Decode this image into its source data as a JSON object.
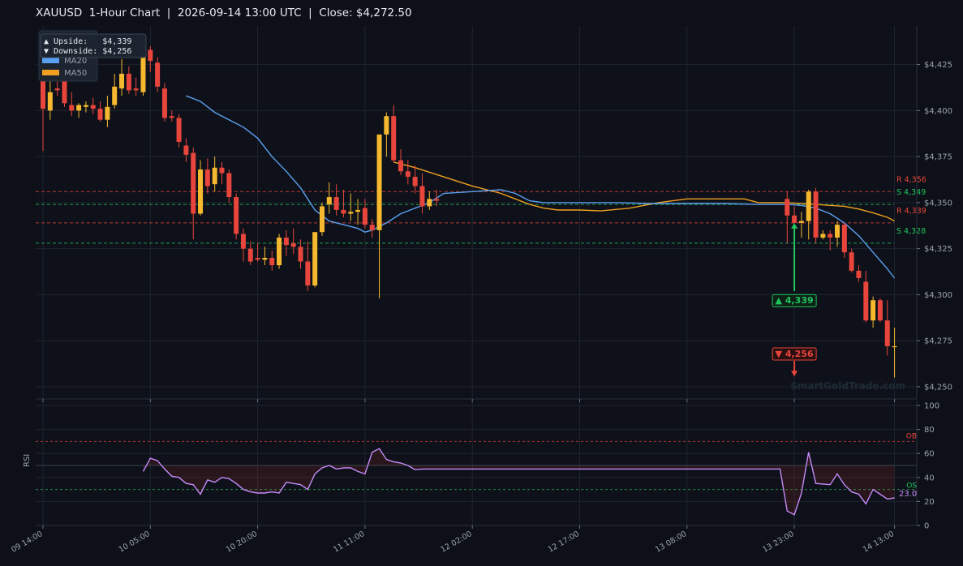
{
  "title": "XAUUSD  1-Hour Chart  |  2026-09-14 13:00 UTC  |  Close: $4,272.50",
  "colors": {
    "bg": "#0d1017",
    "panel": "#0e1119",
    "grid": "#1e242e",
    "up": "#f5b82e",
    "down": "#e8453c",
    "ma20": "#5aa0f0",
    "ma50": "#f0a020",
    "rsi": "#c58af9",
    "resistance": "#e8453c",
    "support": "#22c55e",
    "watermark": "#1f2a36"
  },
  "chart_data": [
    {
      "type": "candlestick",
      "title": "XAUUSD  1-Hour Chart",
      "ylim": [
        4246,
        4442
      ],
      "y_ticks": [
        "$4,250",
        "$4,275",
        "$4,300",
        "$4,325",
        "$4,350",
        "$4,375",
        "$4,400",
        "$4,425"
      ],
      "y_tick_values": [
        4250,
        4275,
        4300,
        4325,
        4350,
        4375,
        4400,
        4425
      ],
      "x_ticks": [
        "09 14:00",
        "10 05:00",
        "10 20:00",
        "11 11:00",
        "12 02:00",
        "12 17:00",
        "13 08:00",
        "13 23:00",
        "14 13:00"
      ],
      "x_tick_index": [
        0,
        15,
        30,
        45,
        60,
        75,
        90,
        105,
        119
      ],
      "ohlc": [
        [
          4418,
          4430,
          4378,
          4401
        ],
        [
          4400,
          4425,
          4395,
          4410
        ],
        [
          4412,
          4432,
          4408,
          4411
        ],
        [
          4422,
          4428,
          4402,
          4404
        ],
        [
          4403,
          4410,
          4397,
          4400
        ],
        [
          4400,
          4404,
          4396,
          4403
        ],
        [
          4402,
          4405,
          4399,
          4403
        ],
        [
          4403,
          4407,
          4398,
          4401
        ],
        [
          4401,
          4405,
          4394,
          4395
        ],
        [
          4395,
          4408,
          4391,
          4402
        ],
        [
          4403,
          4420,
          4401,
          4413
        ],
        [
          4412,
          4428,
          4408,
          4420
        ],
        [
          4420,
          4424,
          4409,
          4411
        ],
        [
          4412,
          4418,
          4408,
          4411
        ],
        [
          4410,
          4432,
          4408,
          4430
        ],
        [
          4433,
          4435,
          4421,
          4427
        ],
        [
          4426,
          4429,
          4410,
          4413
        ],
        [
          4412,
          4415,
          4394,
          4396
        ],
        [
          4397,
          4400,
          4394,
          4396
        ],
        [
          4396,
          4398,
          4380,
          4383
        ],
        [
          4381,
          4385,
          4372,
          4376
        ],
        [
          4377,
          4380,
          4330,
          4344
        ],
        [
          4344,
          4373,
          4343,
          4368
        ],
        [
          4368,
          4374,
          4355,
          4359
        ],
        [
          4360,
          4375,
          4356,
          4369
        ],
        [
          4369,
          4372,
          4360,
          4366
        ],
        [
          4366,
          4368,
          4350,
          4353
        ],
        [
          4353,
          4355,
          4330,
          4333
        ],
        [
          4333,
          4336,
          4318,
          4325
        ],
        [
          4325,
          4329,
          4316,
          4318
        ],
        [
          4320,
          4328,
          4318,
          4319
        ],
        [
          4319,
          4326,
          4316,
          4320
        ],
        [
          4320,
          4324,
          4313,
          4316
        ],
        [
          4316,
          4333,
          4314,
          4331
        ],
        [
          4331,
          4335,
          4321,
          4327
        ],
        [
          4328,
          4336,
          4322,
          4326
        ],
        [
          4326,
          4330,
          4314,
          4318
        ],
        [
          4318,
          4329,
          4302,
          4305
        ],
        [
          4305,
          4327,
          4304,
          4334
        ],
        [
          4334,
          4350,
          4332,
          4348
        ],
        [
          4349,
          4361,
          4344,
          4353
        ],
        [
          4353,
          4360,
          4343,
          4346
        ],
        [
          4346,
          4357,
          4342,
          4344
        ],
        [
          4344,
          4355,
          4340,
          4345
        ],
        [
          4345,
          4352,
          4338,
          4346
        ],
        [
          4347,
          4352,
          4336,
          4338
        ],
        [
          4338,
          4341,
          4331,
          4335
        ],
        [
          4335,
          4378,
          4298,
          4387
        ],
        [
          4387,
          4399,
          4375,
          4397
        ],
        [
          4397,
          4403,
          4372,
          4373
        ],
        [
          4373,
          4379,
          4365,
          4367
        ],
        [
          4367,
          4373,
          4360,
          4364
        ],
        [
          4364,
          4370,
          4355,
          4359
        ],
        [
          4359,
          4366,
          4344,
          4348
        ],
        [
          4348,
          4356,
          4346,
          4352
        ],
        [
          4352,
          4357,
          4348,
          4351
        ]
      ],
      "ohlc_tail": [
        [
          4352,
          4356,
          4328,
          4343
        ],
        [
          4343,
          4348,
          4326,
          4339
        ],
        [
          4339,
          4345,
          4331,
          4340
        ],
        [
          4340,
          4357,
          4330,
          4356
        ],
        [
          4356,
          4358,
          4328,
          4331
        ],
        [
          4331,
          4335,
          4330,
          4333
        ],
        [
          4333,
          4335,
          4324,
          4331
        ],
        [
          4331,
          4340,
          4326,
          4338
        ],
        [
          4338,
          4339,
          4320,
          4323
        ],
        [
          4323,
          4325,
          4312,
          4313
        ],
        [
          4313,
          4316,
          4307,
          4309
        ],
        [
          4307,
          4313,
          4285,
          4286
        ],
        [
          4286,
          4299,
          4282,
          4297
        ],
        [
          4297,
          4298,
          4285,
          4286
        ],
        [
          4286,
          4297,
          4267,
          4272
        ],
        [
          4272,
          4282,
          4255,
          4272
        ]
      ],
      "tail_start_index": 104,
      "ma20": [
        [
          20,
          4408
        ],
        [
          22,
          4405
        ],
        [
          24,
          4399
        ],
        [
          26,
          4395
        ],
        [
          28,
          4391
        ],
        [
          30,
          4385
        ],
        [
          32,
          4375
        ],
        [
          34,
          4367
        ],
        [
          36,
          4358
        ],
        [
          38,
          4346
        ],
        [
          40,
          4340
        ],
        [
          42,
          4338
        ],
        [
          44,
          4336
        ],
        [
          45,
          4334
        ],
        [
          46,
          4335
        ],
        [
          48,
          4339
        ],
        [
          50,
          4344
        ],
        [
          52,
          4347
        ],
        [
          54,
          4350
        ],
        [
          56,
          4355
        ],
        [
          60,
          4356
        ],
        [
          64,
          4357
        ],
        [
          66,
          4355
        ],
        [
          68,
          4351
        ],
        [
          70,
          4350
        ],
        [
          75,
          4350
        ],
        [
          80,
          4350
        ],
        [
          85,
          4349.5
        ],
        [
          90,
          4349.5
        ],
        [
          95,
          4349.5
        ],
        [
          100,
          4349
        ],
        [
          104,
          4349
        ],
        [
          106,
          4348.5
        ],
        [
          108,
          4347
        ],
        [
          110,
          4344
        ],
        [
          112,
          4339
        ],
        [
          114,
          4332
        ],
        [
          116,
          4323
        ],
        [
          118,
          4314
        ],
        [
          119,
          4309
        ]
      ],
      "ma50": [
        [
          49,
          4372
        ],
        [
          52,
          4369
        ],
        [
          56,
          4364
        ],
        [
          60,
          4359
        ],
        [
          64,
          4355
        ],
        [
          66,
          4352
        ],
        [
          68,
          4349
        ],
        [
          70,
          4347
        ],
        [
          72,
          4346
        ],
        [
          75,
          4346
        ],
        [
          78,
          4345.5
        ],
        [
          82,
          4347
        ],
        [
          86,
          4350
        ],
        [
          88,
          4351
        ],
        [
          90,
          4352
        ],
        [
          93,
          4352
        ],
        [
          96,
          4352
        ],
        [
          98,
          4352
        ],
        [
          100,
          4350
        ],
        [
          104,
          4350
        ],
        [
          108,
          4349
        ],
        [
          112,
          4348
        ],
        [
          114,
          4346.5
        ],
        [
          116,
          4344.5
        ],
        [
          118,
          4342
        ],
        [
          119,
          4340
        ]
      ],
      "levels": [
        {
          "label": "R 4,356",
          "value": 4356,
          "kind": "resistance"
        },
        {
          "label": "S 4,349",
          "value": 4349,
          "kind": "support"
        },
        {
          "label": "R 4,339",
          "value": 4339,
          "kind": "resistance"
        },
        {
          "label": "S 4,328",
          "value": 4328,
          "kind": "support"
        }
      ],
      "legend": [
        {
          "name": "MA20"
        },
        {
          "name": "MA50"
        }
      ],
      "targets": {
        "upside_label": "▲ Upside:   $4,339",
        "downside_label": "▼ Downside: $4,256",
        "upside_callout": "▲ 4,339",
        "downside_callout": "▼ 4,256",
        "upside_value": 4339,
        "downside_value": 4256,
        "upside_arrow_from": 4302,
        "downside_arrow_from": 4262,
        "upside_callout_value": 4297,
        "downside_callout_value": 4268,
        "callout_index": 105
      },
      "watermark": "SmartGoldTrade.com"
    },
    {
      "type": "line",
      "ylabel": "RSI",
      "ylim": [
        0,
        100
      ],
      "y_ticks": [
        "0",
        "20",
        "40",
        "60",
        "80",
        "100"
      ],
      "y_tick_values": [
        0,
        20,
        40,
        60,
        80,
        100
      ],
      "overbought": {
        "label": "OB",
        "value": 70
      },
      "oversold": {
        "label": "OS",
        "value": 30
      },
      "midline": 50,
      "last_value_label": "23.0",
      "rsi": [
        [
          14,
          45
        ],
        [
          15,
          56
        ],
        [
          16,
          54
        ],
        [
          17,
          47
        ],
        [
          18,
          41
        ],
        [
          19,
          40
        ],
        [
          20,
          35
        ],
        [
          21,
          34
        ],
        [
          22,
          26
        ],
        [
          23,
          38
        ],
        [
          24,
          36
        ],
        [
          25,
          40
        ],
        [
          26,
          39
        ],
        [
          27,
          35
        ],
        [
          28,
          30
        ],
        [
          29,
          28
        ],
        [
          30,
          27
        ],
        [
          31,
          27
        ],
        [
          32,
          28
        ],
        [
          33,
          27
        ],
        [
          34,
          36
        ],
        [
          35,
          35
        ],
        [
          36,
          34
        ],
        [
          37,
          30
        ],
        [
          38,
          43
        ],
        [
          39,
          48
        ],
        [
          40,
          50
        ],
        [
          41,
          47
        ],
        [
          42,
          48
        ],
        [
          43,
          48
        ],
        [
          44,
          45
        ],
        [
          45,
          43
        ],
        [
          46,
          61
        ],
        [
          47,
          64
        ],
        [
          48,
          55
        ],
        [
          49,
          53
        ],
        [
          50,
          52
        ],
        [
          51,
          50
        ],
        [
          52,
          46.5
        ],
        [
          53,
          47
        ],
        [
          60,
          47
        ],
        [
          70,
          47
        ],
        [
          80,
          47
        ],
        [
          90,
          47
        ],
        [
          100,
          47
        ],
        [
          103,
          47
        ],
        [
          104,
          12
        ],
        [
          105,
          9
        ],
        [
          106,
          27
        ],
        [
          107,
          61
        ],
        [
          108,
          35
        ],
        [
          110,
          34
        ],
        [
          111,
          43
        ],
        [
          112,
          34
        ],
        [
          113,
          28
        ],
        [
          114,
          26
        ],
        [
          115,
          18
        ],
        [
          116,
          30
        ],
        [
          117,
          26
        ],
        [
          118,
          22
        ],
        [
          119,
          23
        ]
      ]
    }
  ]
}
